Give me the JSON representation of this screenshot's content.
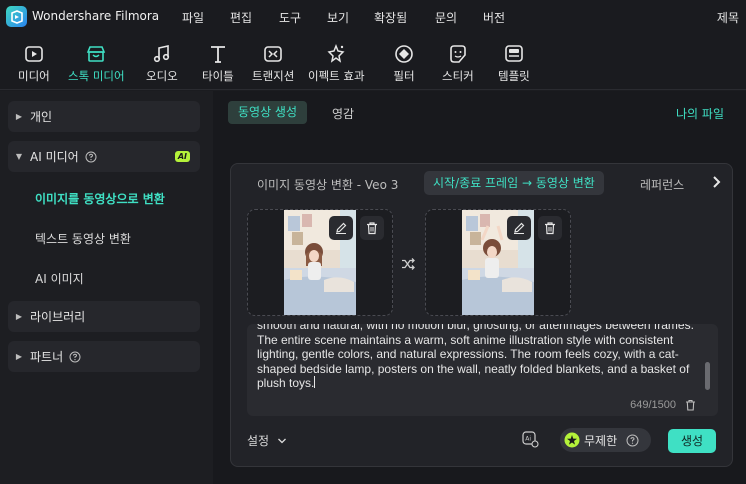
{
  "app": {
    "name": "Wondershare Filmora",
    "title_right": "제목",
    "menu": [
      "파일",
      "편집",
      "도구",
      "보기",
      "확장됨",
      "문의",
      "버전"
    ]
  },
  "toolbar": {
    "items": [
      {
        "label": "미디어",
        "icon": "media-icon"
      },
      {
        "label": "스톡 미디어",
        "icon": "stock-media-icon",
        "active": true
      },
      {
        "label": "오디오",
        "icon": "audio-icon"
      },
      {
        "label": "타이틀",
        "icon": "title-icon"
      },
      {
        "label": "트랜지션",
        "icon": "transition-icon"
      },
      {
        "label": "이펙트 효과",
        "icon": "effects-icon"
      },
      {
        "label": "필터",
        "icon": "filter-icon"
      },
      {
        "label": "스티커",
        "icon": "sticker-icon"
      },
      {
        "label": "템플릿",
        "icon": "template-icon"
      }
    ]
  },
  "sidebar": {
    "personal": "개인",
    "ai_media": "AI 미디어",
    "ai_badge": "AI",
    "ai_items": [
      "이미지를 동영상으로 변환",
      "텍스트 동영상 변환",
      "AI 이미지"
    ],
    "library": "라이브러리",
    "partner": "파트너"
  },
  "main": {
    "tab_active": "동영상 생성",
    "tab_other": "영감",
    "my_files": "나의 파일",
    "sub_tabs": [
      "이미지 동영상 변환 - Veo 3",
      "시작/종료 프레임 → 동영상 변환",
      "레퍼런스"
    ],
    "prompt": "smooth and natural, with no motion blur, ghosting, or afterimages between frames. The entire scene maintains a warm, soft anime illustration style with consistent lighting, gentle colors, and natural expressions. The room feels cozy, with a cat-shaped bedside lamp, posters on the wall, neatly folded blankets, and a basket of plush toys.",
    "char_count": "649/1500",
    "settings_label": "설정",
    "credit_label": "무제한",
    "generate_label": "생성"
  },
  "colors": {
    "accent": "#3fe0c4",
    "ai_badge": "#b4f23a",
    "background": "#1b1c20",
    "panel": "#222328"
  }
}
